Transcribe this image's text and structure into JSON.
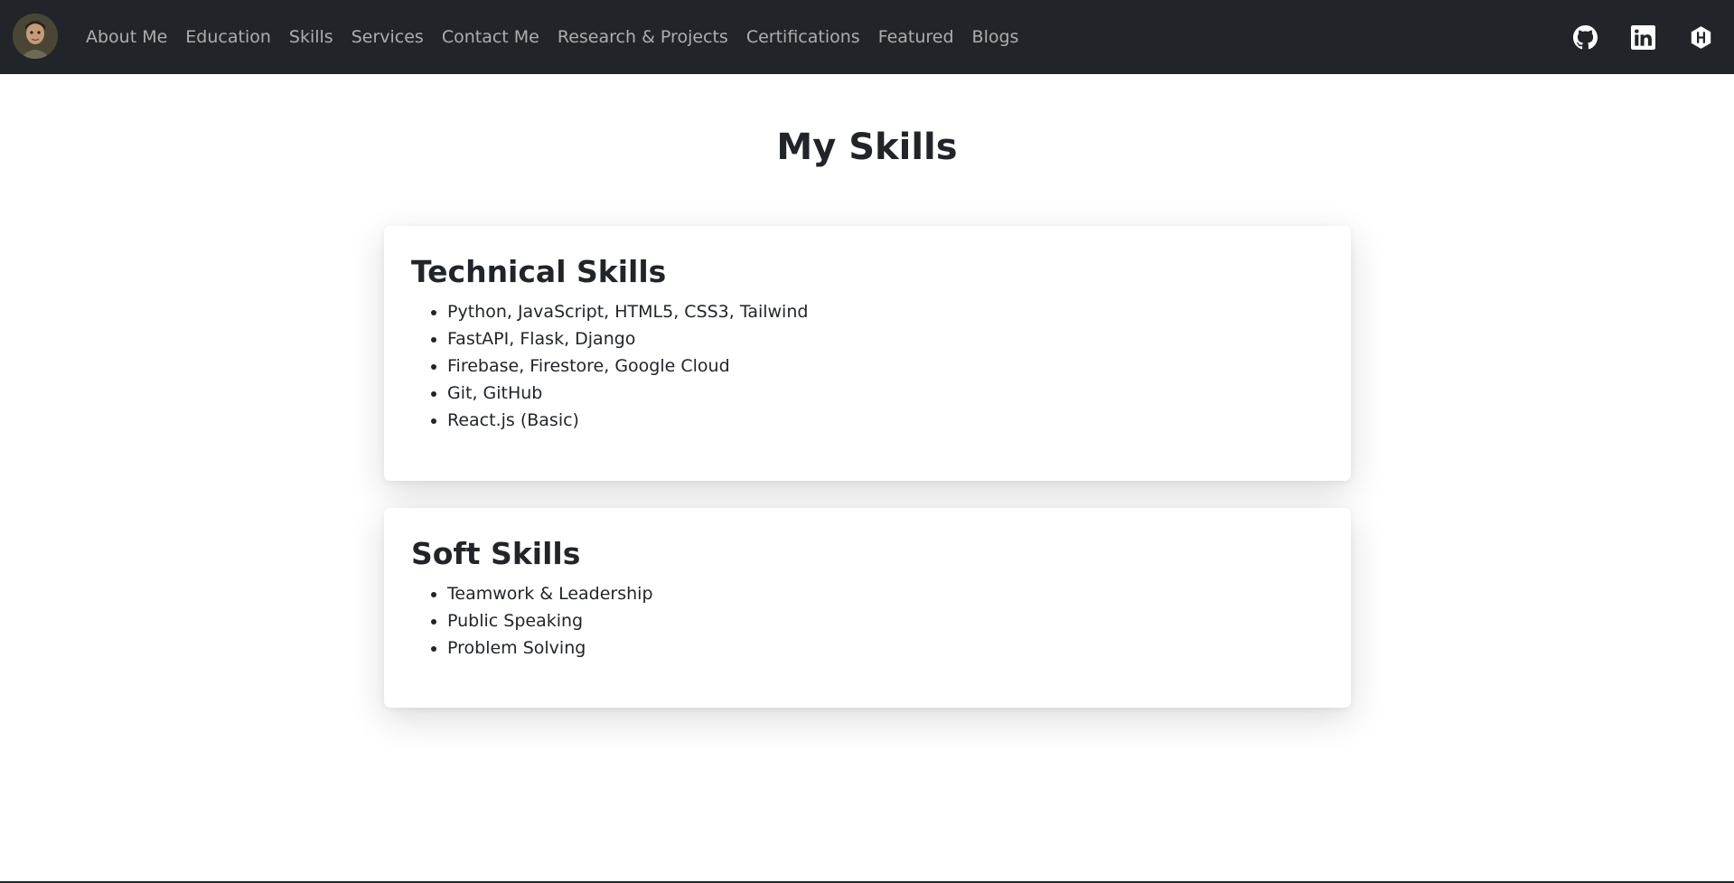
{
  "navbar": {
    "links": [
      "About Me",
      "Education",
      "Skills",
      "Services",
      "Contact Me",
      "Research & Projects",
      "Certifications",
      "Featured",
      "Blogs"
    ],
    "icons": [
      "github-icon",
      "linkedin-icon",
      "hashnode-icon"
    ],
    "background_color": "#212529",
    "link_color": "rgba(255,255,255,0.62)"
  },
  "main": {
    "title": "My Skills",
    "technical": {
      "heading": "Technical Skills",
      "items": [
        "Python, JavaScript, HTML5, CSS3, Tailwind",
        "FastAPI, Flask, Django",
        "Firebase, Firestore, Google Cloud",
        "Git, GitHub",
        "React.js (Basic)"
      ]
    },
    "soft": {
      "heading": "Soft Skills",
      "items": [
        "Teamwork & Leadership",
        "Public Speaking",
        "Problem Solving"
      ]
    }
  }
}
